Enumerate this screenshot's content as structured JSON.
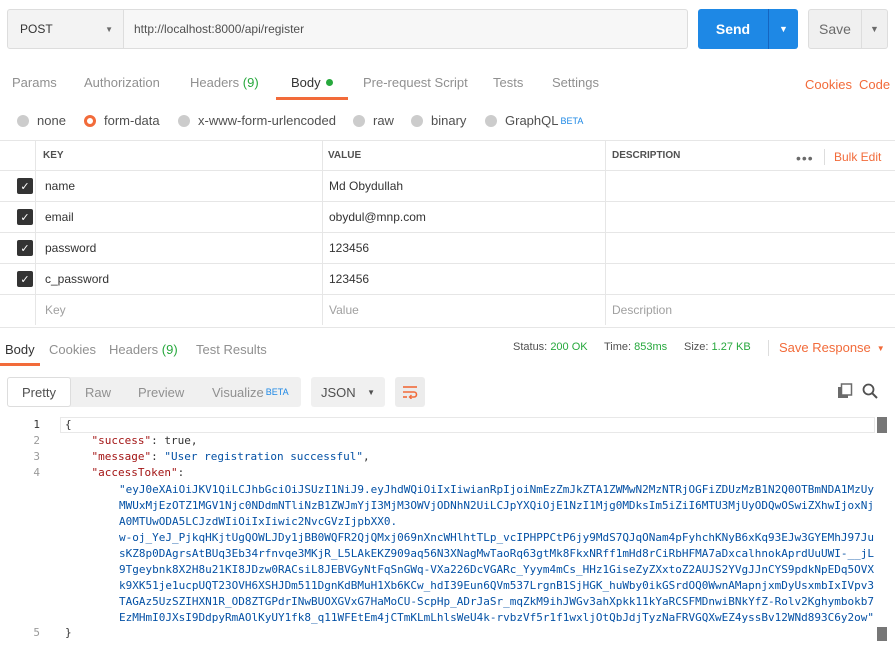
{
  "request": {
    "method": "POST",
    "url": "http://localhost:8000/api/register",
    "send_label": "Send",
    "save_label": "Save"
  },
  "req_tabs": {
    "params": "Params",
    "authorization": "Authorization",
    "headers": "Headers",
    "headers_count": "(9)",
    "body": "Body",
    "prerequest": "Pre-request Script",
    "tests": "Tests",
    "settings": "Settings",
    "cookies": "Cookies",
    "code": "Code"
  },
  "body_types": {
    "none": "none",
    "form_data": "form-data",
    "urlencoded": "x-www-form-urlencoded",
    "raw": "raw",
    "binary": "binary",
    "graphql": "GraphQL",
    "beta": "BETA"
  },
  "params_table": {
    "headers": {
      "key": "KEY",
      "value": "VALUE",
      "description": "DESCRIPTION",
      "bulk_edit": "Bulk Edit"
    },
    "rows": [
      {
        "key": "name",
        "value": "Md Obydullah"
      },
      {
        "key": "email",
        "value": "obydul@mnp.com"
      },
      {
        "key": "password",
        "value": "123456"
      },
      {
        "key": "c_password",
        "value": "123456"
      }
    ],
    "placeholders": {
      "key": "Key",
      "value": "Value",
      "description": "Description"
    }
  },
  "resp_tabs": {
    "body": "Body",
    "cookies": "Cookies",
    "headers": "Headers",
    "headers_count": "(9)",
    "test_results": "Test Results"
  },
  "status": {
    "status_label": "Status:",
    "status_value": "200 OK",
    "time_label": "Time:",
    "time_value": "853ms",
    "size_label": "Size:",
    "size_value": "1.27 KB",
    "save_response": "Save Response"
  },
  "format": {
    "pretty": "Pretty",
    "raw": "Raw",
    "preview": "Preview",
    "visualize": "Visualize",
    "beta": "BETA",
    "json": "JSON"
  },
  "code": {
    "line_numbers": [
      "1",
      "2",
      "3",
      "4",
      "5"
    ],
    "open_brace": "{",
    "close_brace": "}",
    "success_key": "\"success\"",
    "success_value": "true",
    "message_key": "\"message\"",
    "message_value": "\"User registration successful\"",
    "token_key": "\"accessToken\"",
    "token_lines": [
      "\"eyJ0eXAiOiJKV1QiLCJhbGciOiJSUzI1NiJ9.eyJhdWQiOiIxIiwianRpIjoiNmEzZmJkZTA1ZWMwN2MzNTRjOGFiZDUzMzB1N2Q0OTBmNDA1MzUy",
      "MWUxMjEzOTZ1MGV1Njc0NDdmNTliNzB1ZWJmYjI3MjM3OWVjODNhN2UiLCJpYXQiOjE1NzI1Mjg0MDksIm5iZiI6MTU3MjUyODQwOSwiZXhwIjoxNj",
      "A0MTUwODA5LCJzdWIiOiIxIiwic2NvcGVzIjpbXX0.",
      "w-oj_YeJ_PjkqHKjtUgQOWLJDy1jBB0WQFR2QjQMxj069nXncWHlhtTLp_vcIPHPPCtP6jy9MdS7QJqONam4pFyhchKNyB6xKq93EJw3GYEMhJ97Ju",
      "sKZ8p0DAgrsAtBUq3Eb34rfnvqe3MKjR_L5LAkEKZ909aq56N3XNagMwTaoRq63gtMk8FkxNRff1mHd8rCiRbHFMA7aDxcalhnokAprdUuUWI-__jL",
      "9Tgeybnk8X2H8u21KI8JDzw0RACsiL8JEBVGyNtFqSnGWq-VXa226DcVGARc_Yyym4mCs_HHz1GiseZyZXxtoZ2AUJS2YVgJJnCYS9pdkNpEDq5OVX",
      "k9XK51je1ucpUQT23OVH6XSHJDm511DgnKdBMuH1Xb6KCw_hdI39Eun6QVm537LrgnB1SjHGK_huWby0ikGSrdOQ0WwnAMapnjxmDyUsxmbIxIVpv3",
      "TAGAz5UzSZIHXN1R_OD8ZTGPdrINwBUOXGVxG7HaMoCU-ScpHp_ADrJaSr_mqZkM9ihJWGv3ahXpkk11kYaRCSFMDnwiBNkYfZ-Rolv2Kghymbokb7",
      "EzMHmI0JXsI9DdpyRmAOlKyUY1fk8_q11WFEtEm4jCTmKLmLhlsWeU4k-rvbzVf5r1f1wxljOtQbJdjTyzNaFRVGQXwEZ4yssBv12WNd893C6y2ow\""
    ]
  }
}
